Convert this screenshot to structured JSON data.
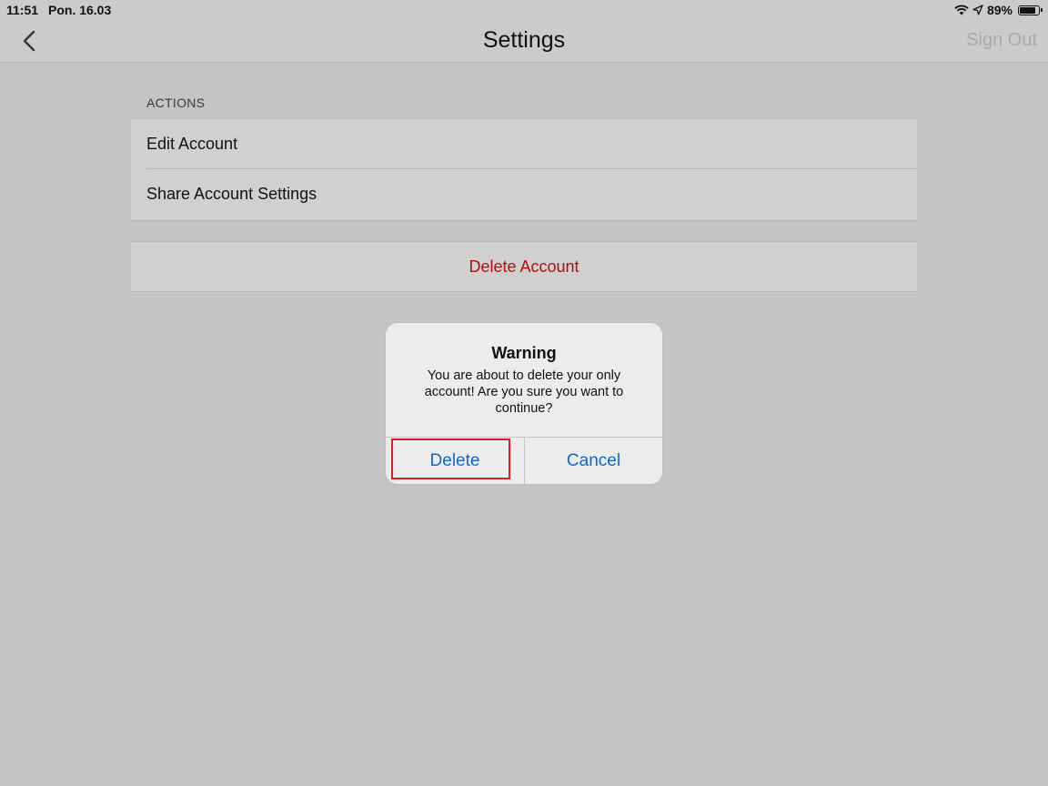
{
  "status_bar": {
    "time": "11:51",
    "date": "Pon. 16.03",
    "battery": "89%",
    "battery_level": 0.89
  },
  "nav": {
    "title": "Settings",
    "sign_out_label": "Sign Out"
  },
  "actions_section": {
    "header": "ACTIONS",
    "items": [
      {
        "label": "Edit Account"
      },
      {
        "label": "Share Account Settings"
      }
    ]
  },
  "delete_section": {
    "label": "Delete Account",
    "color": "#b00f10"
  },
  "alert": {
    "title": "Warning",
    "message": "You are about to delete your only account! Are you sure you want to continue?",
    "delete_label": "Delete",
    "cancel_label": "Cancel",
    "button_color": "#1466c8"
  },
  "highlight": {
    "color": "#d61f26"
  }
}
